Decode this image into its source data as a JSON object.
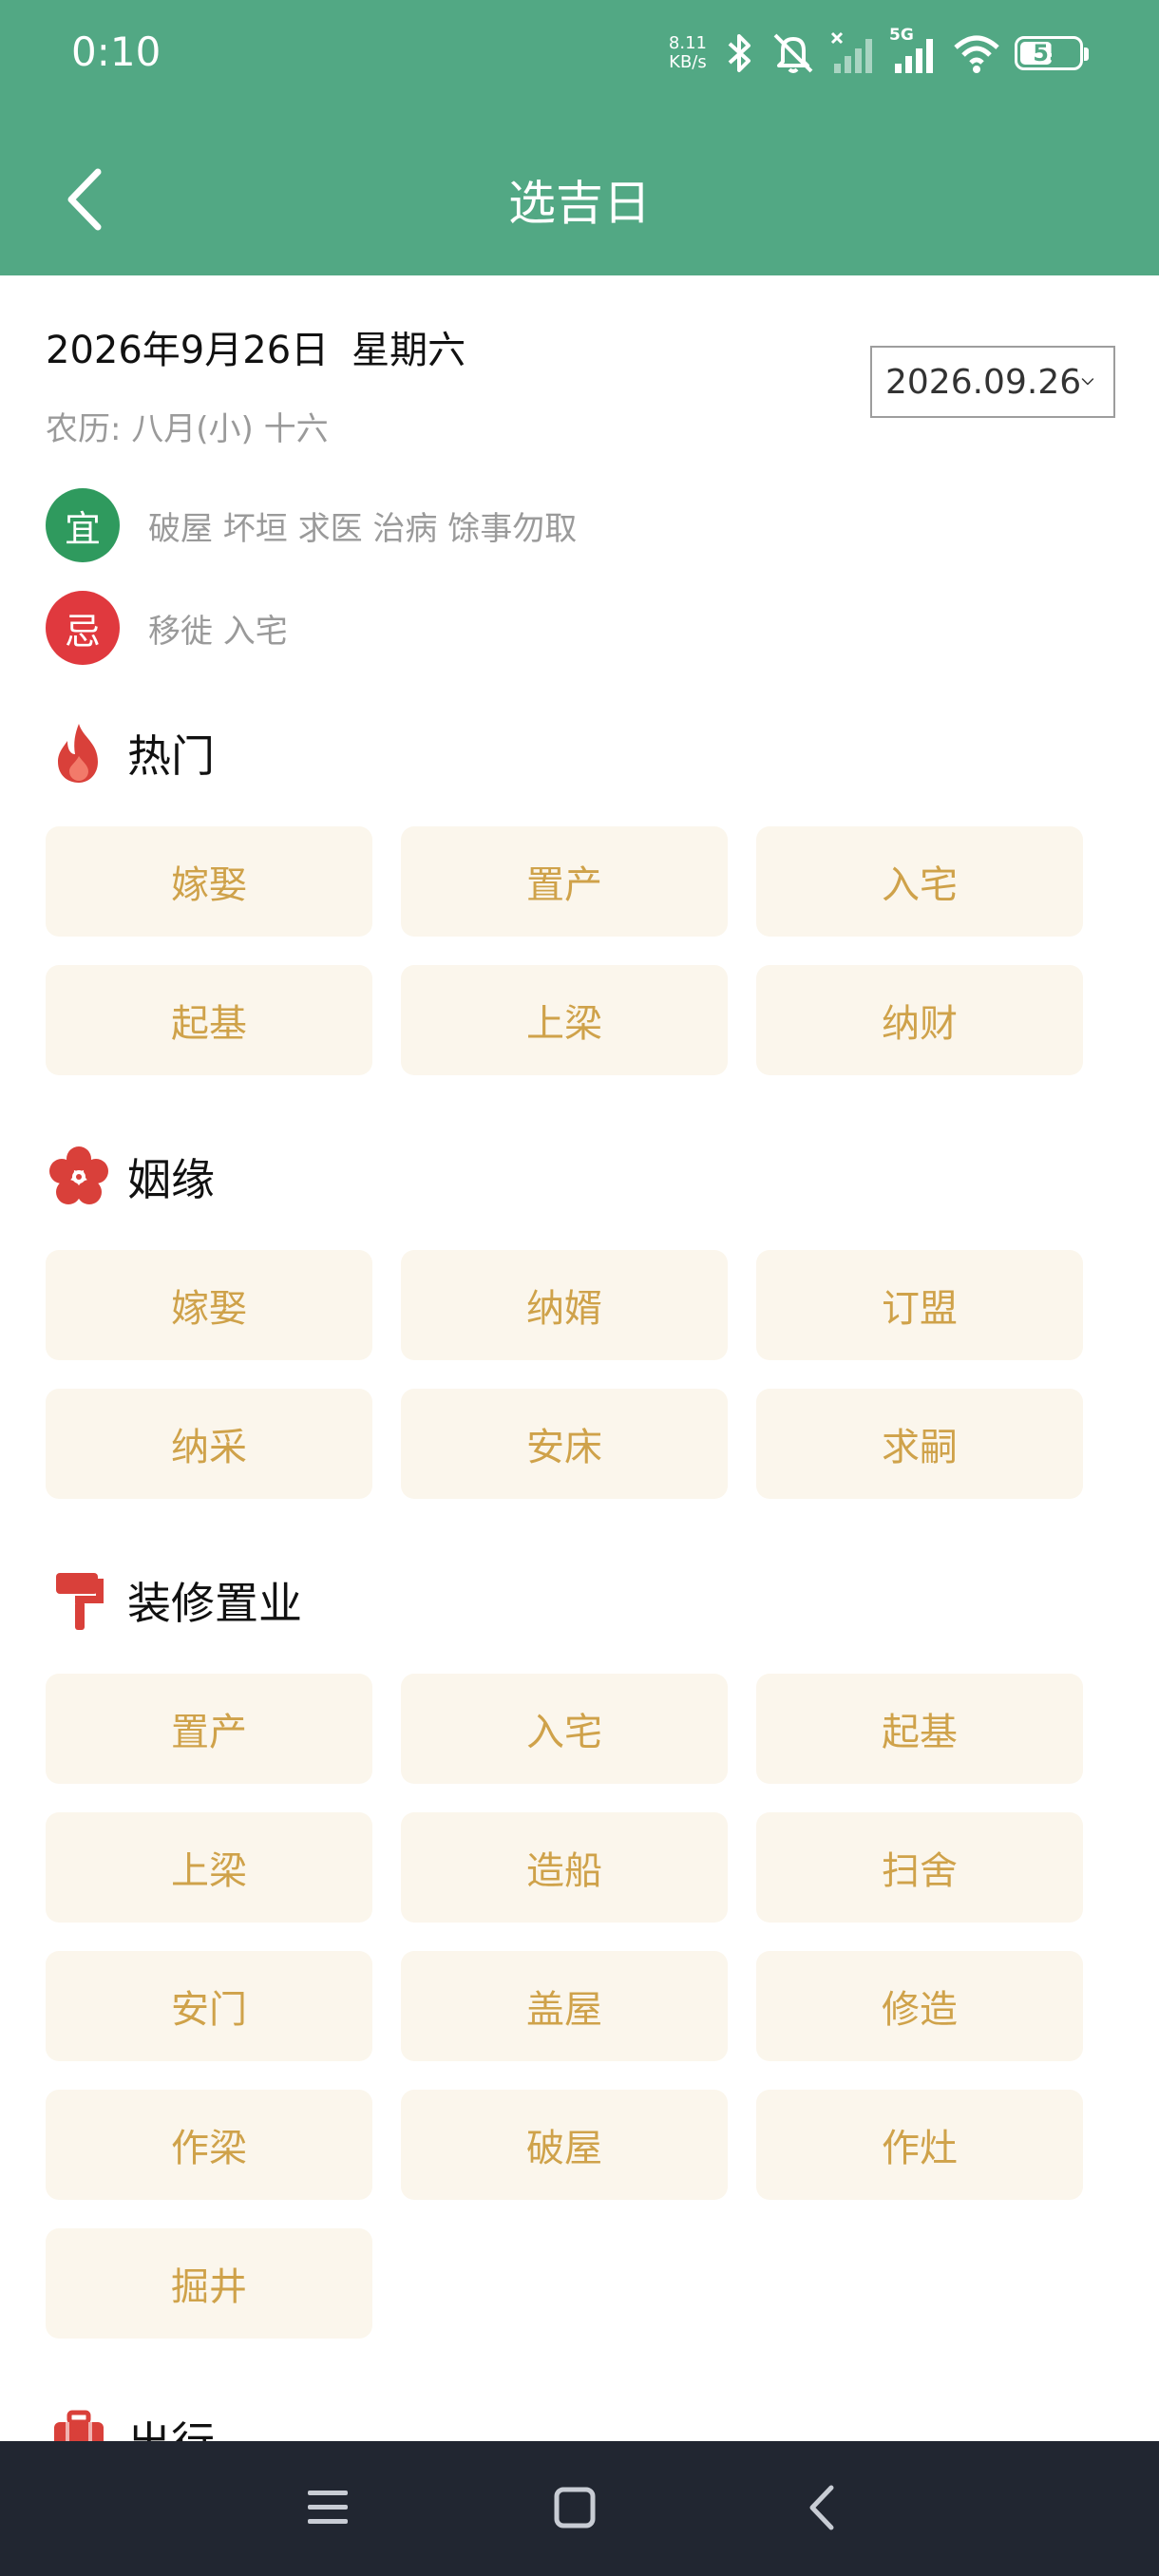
{
  "status_bar": {
    "time": "0:10",
    "net_speed_value": "8.11",
    "net_speed_unit": "KB/s",
    "network_type": "5G",
    "battery_level": "55",
    "battery_percent": 55,
    "icons": [
      "bluetooth-icon",
      "mute-icon",
      "signal-off-icon",
      "signal-icon",
      "wifi-icon",
      "battery-icon"
    ]
  },
  "toolbar": {
    "title": "选吉日",
    "back_icon": "chevron-left-icon"
  },
  "date_info": {
    "date": "2026年9月26日",
    "weekday": "星期六",
    "lunar": "农历: 八月(小) 十六",
    "picker_value": "2026.09.26",
    "picker_icon": "chevron-down-icon"
  },
  "yi": {
    "badge": "宜",
    "text": "破屋 坏垣 求医 治病 馀事勿取",
    "color": "#2f9a5e"
  },
  "ji": {
    "badge": "忌",
    "text": "移徙 入宅",
    "color": "#e0393e"
  },
  "categories": [
    {
      "title": "热门",
      "icon": "fire-icon",
      "items": [
        "嫁娶",
        "置产",
        "入宅",
        "起基",
        "上梁",
        "纳财"
      ]
    },
    {
      "title": "姻缘",
      "icon": "flower-icon",
      "items": [
        "嫁娶",
        "纳婿",
        "订盟",
        "纳采",
        "安床",
        "求嗣"
      ]
    },
    {
      "title": "装修置业",
      "icon": "paint-roller-icon",
      "items": [
        "置产",
        "入宅",
        "起基",
        "上梁",
        "造船",
        "扫舍",
        "安门",
        "盖屋",
        "修造",
        "作梁",
        "破屋",
        "作灶",
        "掘井"
      ]
    },
    {
      "title": "出行",
      "icon": "suitcase-icon",
      "items": []
    }
  ],
  "colors": {
    "header": "#52a884",
    "chip_bg": "#fbf6ec",
    "chip_text": "#cfa24a",
    "icon_red": "#d9403a",
    "nav_bar": "#212631"
  },
  "nav_bar": {
    "icons": [
      "menu-icon",
      "home-icon",
      "back-icon"
    ]
  }
}
